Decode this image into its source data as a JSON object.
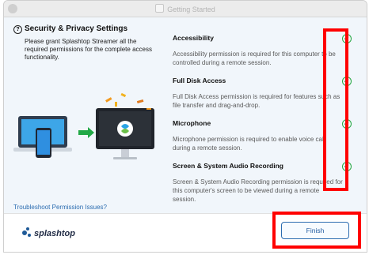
{
  "window": {
    "title": "Getting Started"
  },
  "left": {
    "heading": "Security & Privacy Settings",
    "description": "Please grant Splashtop Streamer all the required permissions for the complete access functionality.",
    "troubleshoot_link": "Troubleshoot Permission Issues?"
  },
  "permissions": [
    {
      "title": "Accessibility",
      "description": "Accessibility permission is required for this computer to be controlled during a remote session.",
      "status": "granted"
    },
    {
      "title": "Full Disk Access",
      "description": "Full Disk Access permission is required for features such as file transfer and drag-and-drop.",
      "status": "granted"
    },
    {
      "title": "Microphone",
      "description": "Microphone permission is required to enable voice call during a remote session.",
      "status": "granted"
    },
    {
      "title": "Screen & System Audio Recording",
      "description": "Screen & System Audio Recording permission is required for this computer's screen to be viewed during a remote session.",
      "status": "granted"
    }
  ],
  "footer": {
    "logo_text": "splashtop",
    "finish_label": "Finish"
  },
  "colors": {
    "check_green": "#27a844",
    "accent_blue": "#2b6cb0",
    "highlight_red": "#ff0000"
  }
}
